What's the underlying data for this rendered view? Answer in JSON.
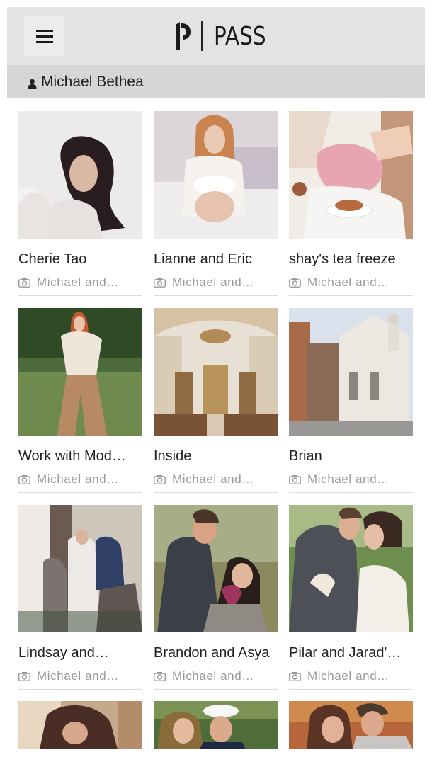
{
  "header": {
    "brand": "PASS",
    "menu_icon": "hamburger-icon"
  },
  "user": {
    "name": "Michael Bethea",
    "icon": "person-icon"
  },
  "galleries": [
    {
      "title": "Cherie Tao",
      "owner": "Michael and…"
    },
    {
      "title": "Lianne and Eric",
      "owner": "Michael and…"
    },
    {
      "title": "shay's tea freeze",
      "owner": "Michael and…"
    },
    {
      "title": "Work with Mod…",
      "owner": "Michael and…"
    },
    {
      "title": "Inside",
      "owner": "Michael and…"
    },
    {
      "title": "Brian",
      "owner": "Michael and…"
    },
    {
      "title": "Lindsay and…",
      "owner": "Michael and…"
    },
    {
      "title": "Brandon and Asya",
      "owner": "Michael and…"
    },
    {
      "title": "Pilar and Jarad'…",
      "owner": "Michael and…"
    }
  ],
  "colors": {
    "header_bg": "#e3e3e3",
    "userbar_bg": "#d6d6d6",
    "subtext": "#9a9a9a"
  }
}
